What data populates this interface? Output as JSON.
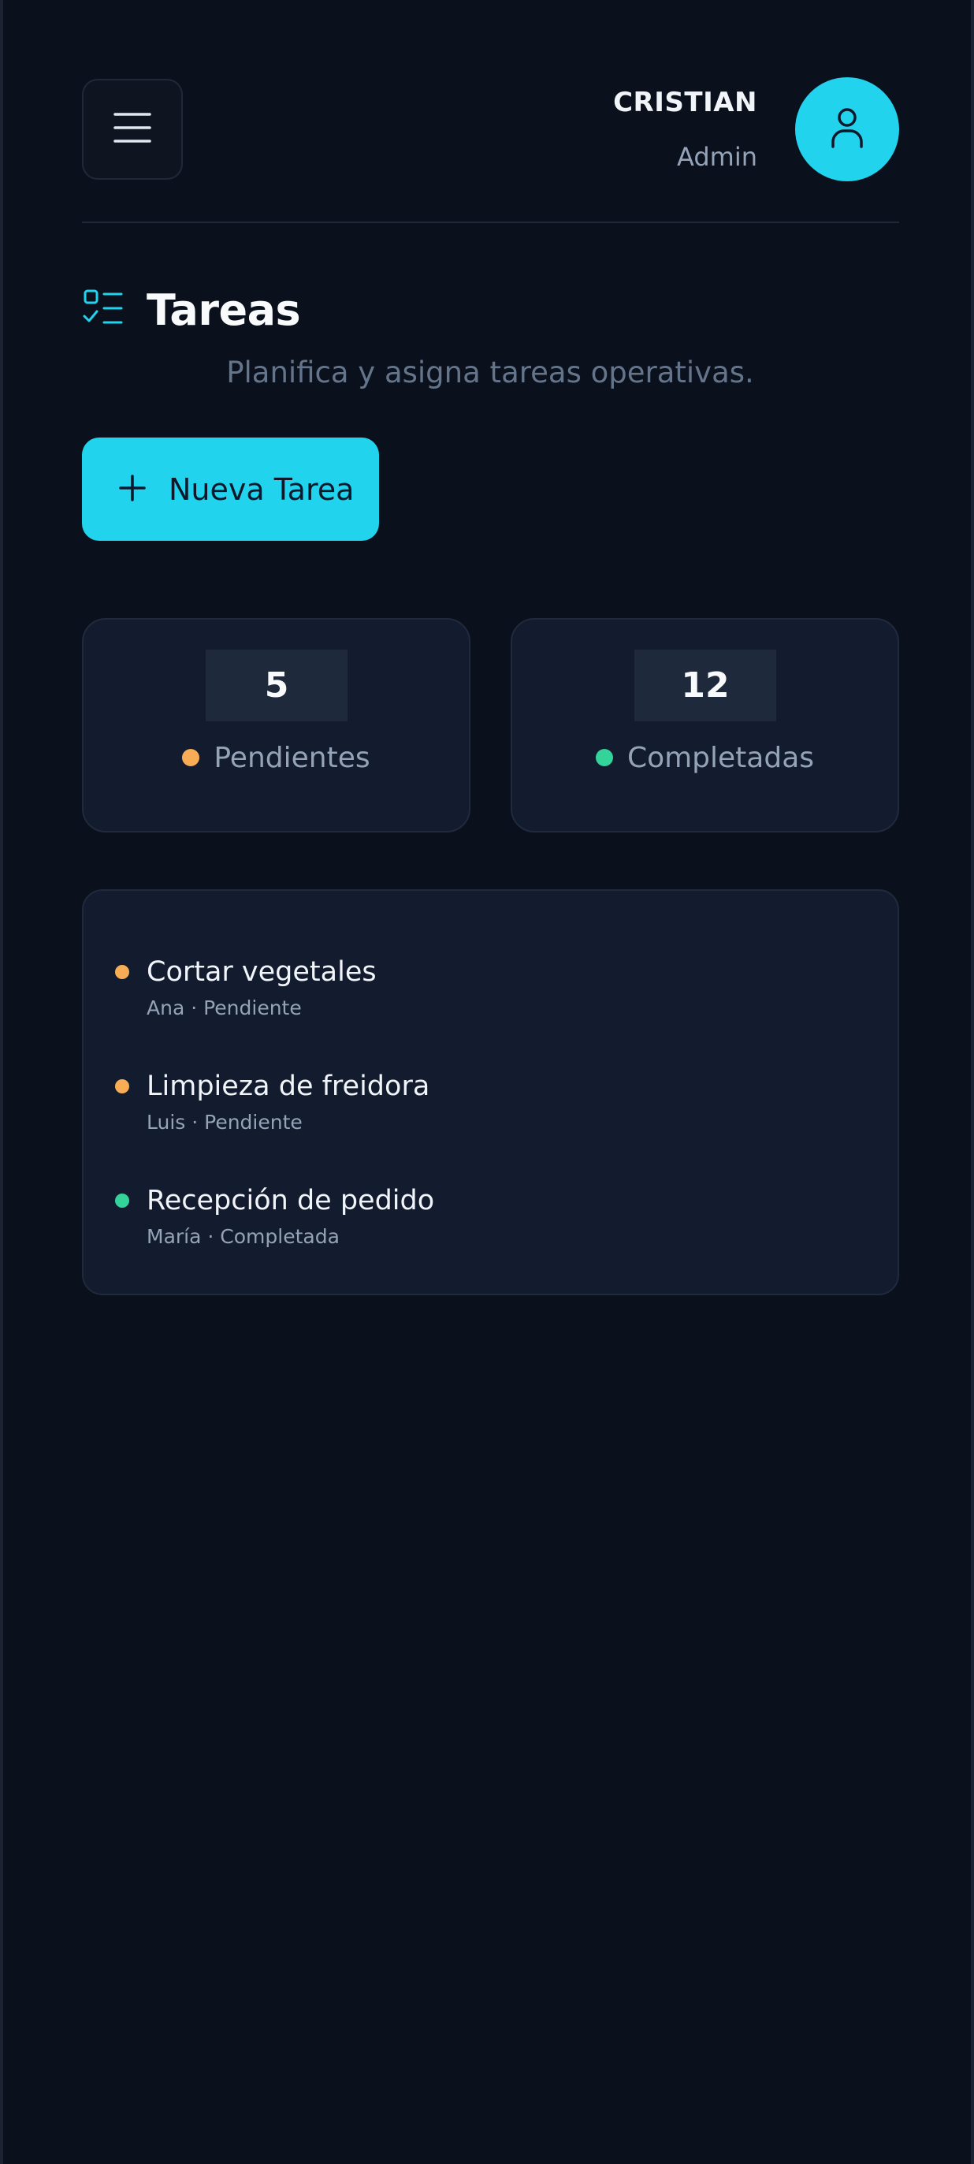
{
  "header": {
    "user_name": "CRISTIAN",
    "user_role": "Admin",
    "menu_icon": "hamburger-menu-icon",
    "avatar_icon": "user-icon"
  },
  "page": {
    "title": "Tareas",
    "title_icon": "task-list-icon",
    "subtitle": "Planifica y asigna tareas operativas."
  },
  "actions": {
    "new_task_label": "Nueva Tarea",
    "new_task_icon": "plus-icon"
  },
  "stats": [
    {
      "value": "5",
      "label": "Pendientes",
      "color": "#f6ad55"
    },
    {
      "value": "12",
      "label": "Completadas",
      "color": "#34d399"
    }
  ],
  "tasks": [
    {
      "title": "Cortar vegetales",
      "meta": "Ana · Pendiente",
      "color": "#f6ad55"
    },
    {
      "title": "Limpieza de freidora",
      "meta": "Luis · Pendiente",
      "color": "#f6ad55"
    },
    {
      "title": "Recepción de pedido",
      "meta": "María · Completada",
      "color": "#34d399"
    }
  ],
  "colors": {
    "accent": "#22d3ee",
    "background": "#0b111c",
    "card": "#121c2e",
    "pending": "#f6ad55",
    "completed": "#34d399"
  }
}
